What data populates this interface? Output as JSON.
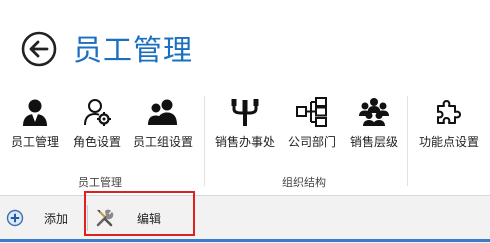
{
  "page": {
    "title": "员工管理"
  },
  "ribbon": {
    "groups": [
      {
        "label": "员工管理",
        "items": [
          {
            "label": "员工管理",
            "icon": "person-icon"
          },
          {
            "label": "角色设置",
            "icon": "person-gear-icon"
          },
          {
            "label": "员工组设置",
            "icon": "group-icon"
          }
        ]
      },
      {
        "label": "组织结构",
        "items": [
          {
            "label": "销售办事处",
            "icon": "branch-icon"
          },
          {
            "label": "公司部门",
            "icon": "org-chart-icon"
          },
          {
            "label": "销售层级",
            "icon": "team-icon"
          }
        ]
      },
      {
        "label": "",
        "items": [
          {
            "label": "功能点设置",
            "icon": "puzzle-icon"
          }
        ]
      }
    ]
  },
  "toolbar": {
    "add_label": "添加",
    "edit_label": "编辑"
  },
  "colors": {
    "title": "#1a6fc1",
    "highlight": "#e02020",
    "accent": "#3a7cc6"
  }
}
